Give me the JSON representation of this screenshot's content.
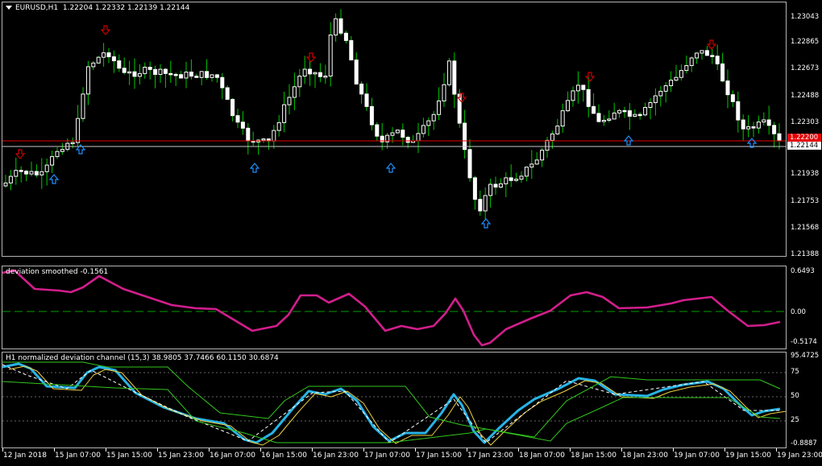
{
  "main": {
    "symbol_label": "EURUSD,H1",
    "ohlc": "1.22204 1.22332 1.22139 1.22144",
    "axis_labels": [
      "1.23043",
      "1.22865",
      "1.22673",
      "1.22488",
      "1.22303",
      "1.22144",
      "1.21938",
      "1.21753",
      "1.21568",
      "1.21388"
    ],
    "current_price": "1.22144",
    "red_line_label": "1.22200",
    "colors": {
      "bull": "#ffffff",
      "bear": "#ffffff",
      "wick": "#00c800",
      "red_line": "#e60000",
      "up_arrow": "#1e90ff",
      "down_arrow": "#c80000"
    }
  },
  "deviation": {
    "label": "deviation smoothed -0.1561",
    "axis_labels": [
      "0.6493",
      "0.00",
      "-0.5174"
    ],
    "colors": {
      "line": "#d21e8c",
      "zero": "#00a000"
    }
  },
  "ndc": {
    "label": "H1  normalized deviation channel (15,3) 38.9805 37.7466 60.1150 30.6874",
    "axis_labels": [
      "95.4725",
      "75",
      "50",
      "25",
      "-0.8887"
    ],
    "colors": {
      "main": "#28b4e6",
      "signal": "#f0d040",
      "dashed": "#ffffff",
      "channel": "#32c81e"
    }
  },
  "time_labels": [
    "12 Jan 2018",
    "15 Jan 07:00",
    "15 Jan 15:00",
    "15 Jan 23:00",
    "16 Jan 07:00",
    "16 Jan 15:00",
    "16 Jan 23:00",
    "17 Jan 07:00",
    "17 Jan 15:00",
    "17 Jan 23:00",
    "18 Jan 07:00",
    "18 Jan 15:00",
    "18 Jan 23:00",
    "19 Jan 07:00",
    "19 Jan 15:00",
    "19 Jan 23:00"
  ]
}
